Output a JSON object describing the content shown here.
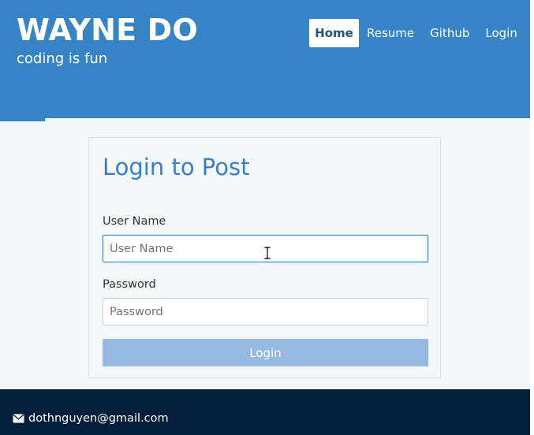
{
  "site": {
    "brand_title": "WAYNE DO",
    "brand_subtitle": "coding is fun"
  },
  "nav": {
    "items": [
      {
        "label": "Home",
        "active": true
      },
      {
        "label": "Resume",
        "active": false
      },
      {
        "label": "Github",
        "active": false
      },
      {
        "label": "Login",
        "active": false
      }
    ]
  },
  "login": {
    "title": "Login to Post",
    "username_label": "User Name",
    "username_placeholder": "User Name",
    "username_value": "",
    "password_label": "Password",
    "password_placeholder": "Password",
    "password_value": "",
    "button_label": "Login"
  },
  "footer": {
    "email": "dothnguyen@gmail.com",
    "icon": "envelope-icon"
  },
  "colors": {
    "header": "#3683c5",
    "page": "#f3f7f8",
    "title": "#3b7fc2",
    "button": "#95b9e0",
    "footer": "#031f3b"
  }
}
